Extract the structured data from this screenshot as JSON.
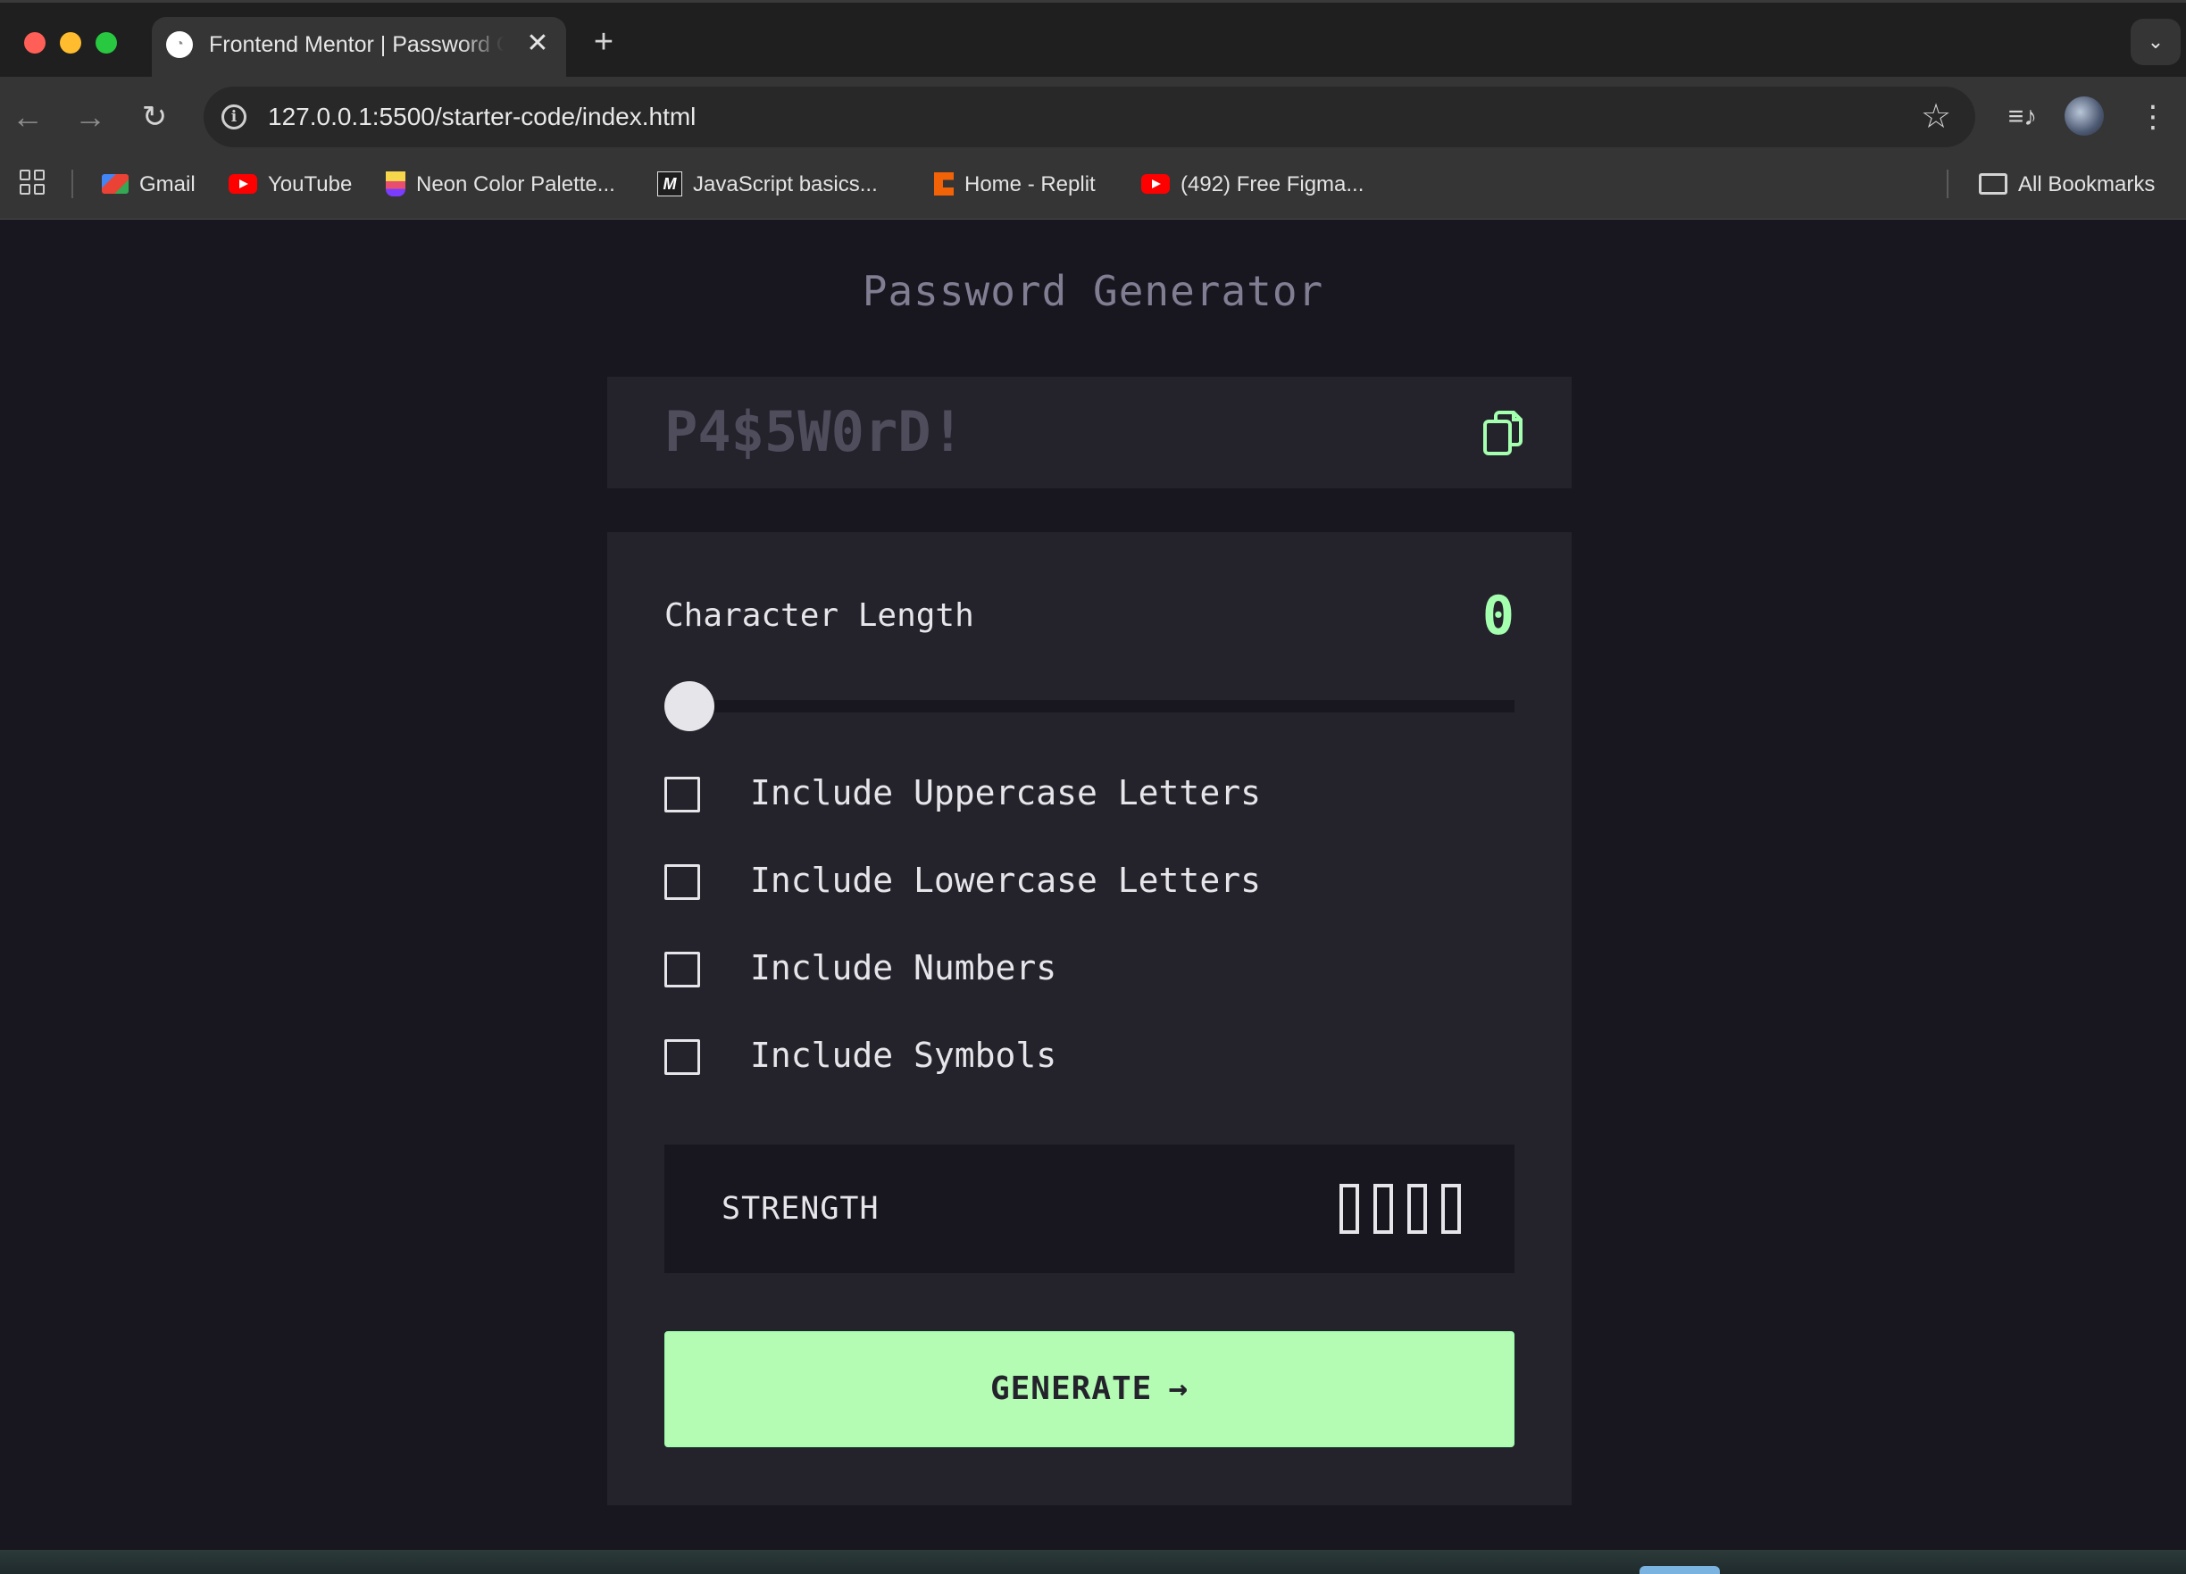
{
  "browser": {
    "tab_title": "Frontend Mentor | Password Generator",
    "tab_close": "✕",
    "new_tab": "+",
    "url": "127.0.0.1:5500/starter-code/index.html",
    "bookmarks": [
      {
        "label": "Gmail",
        "icon": "gmail-icon"
      },
      {
        "label": "YouTube",
        "icon": "youtube-icon"
      },
      {
        "label": "Neon Color Palette...",
        "icon": "neon-palette-icon"
      },
      {
        "label": "JavaScript basics...",
        "icon": "javascript-basics-icon"
      },
      {
        "label": "Home - Replit",
        "icon": "replit-icon"
      },
      {
        "label": "(492) Free Figma...",
        "icon": "youtube-icon"
      }
    ],
    "all_bookmarks": "All Bookmarks"
  },
  "app": {
    "title": "Password Generator",
    "password": "P4$5W0rD!",
    "char_length_label": "Character Length",
    "char_length_value": "0",
    "slider": {
      "min": 0,
      "max": 20,
      "value": 0
    },
    "options": [
      {
        "label": "Include Uppercase Letters",
        "checked": false
      },
      {
        "label": "Include Lowercase Letters",
        "checked": false
      },
      {
        "label": "Include Numbers",
        "checked": false
      },
      {
        "label": "Include Symbols",
        "checked": false
      }
    ],
    "strength_label": "STRENGTH",
    "strength_level": 0,
    "generate_label": "GENERATE",
    "generate_arrow": "→"
  },
  "colors": {
    "background": "#18171f",
    "panel": "#24232c",
    "accent": "#a4ffaf",
    "button": "#b4fcb4",
    "text": "#e6e5ea",
    "muted": "#817d92"
  }
}
